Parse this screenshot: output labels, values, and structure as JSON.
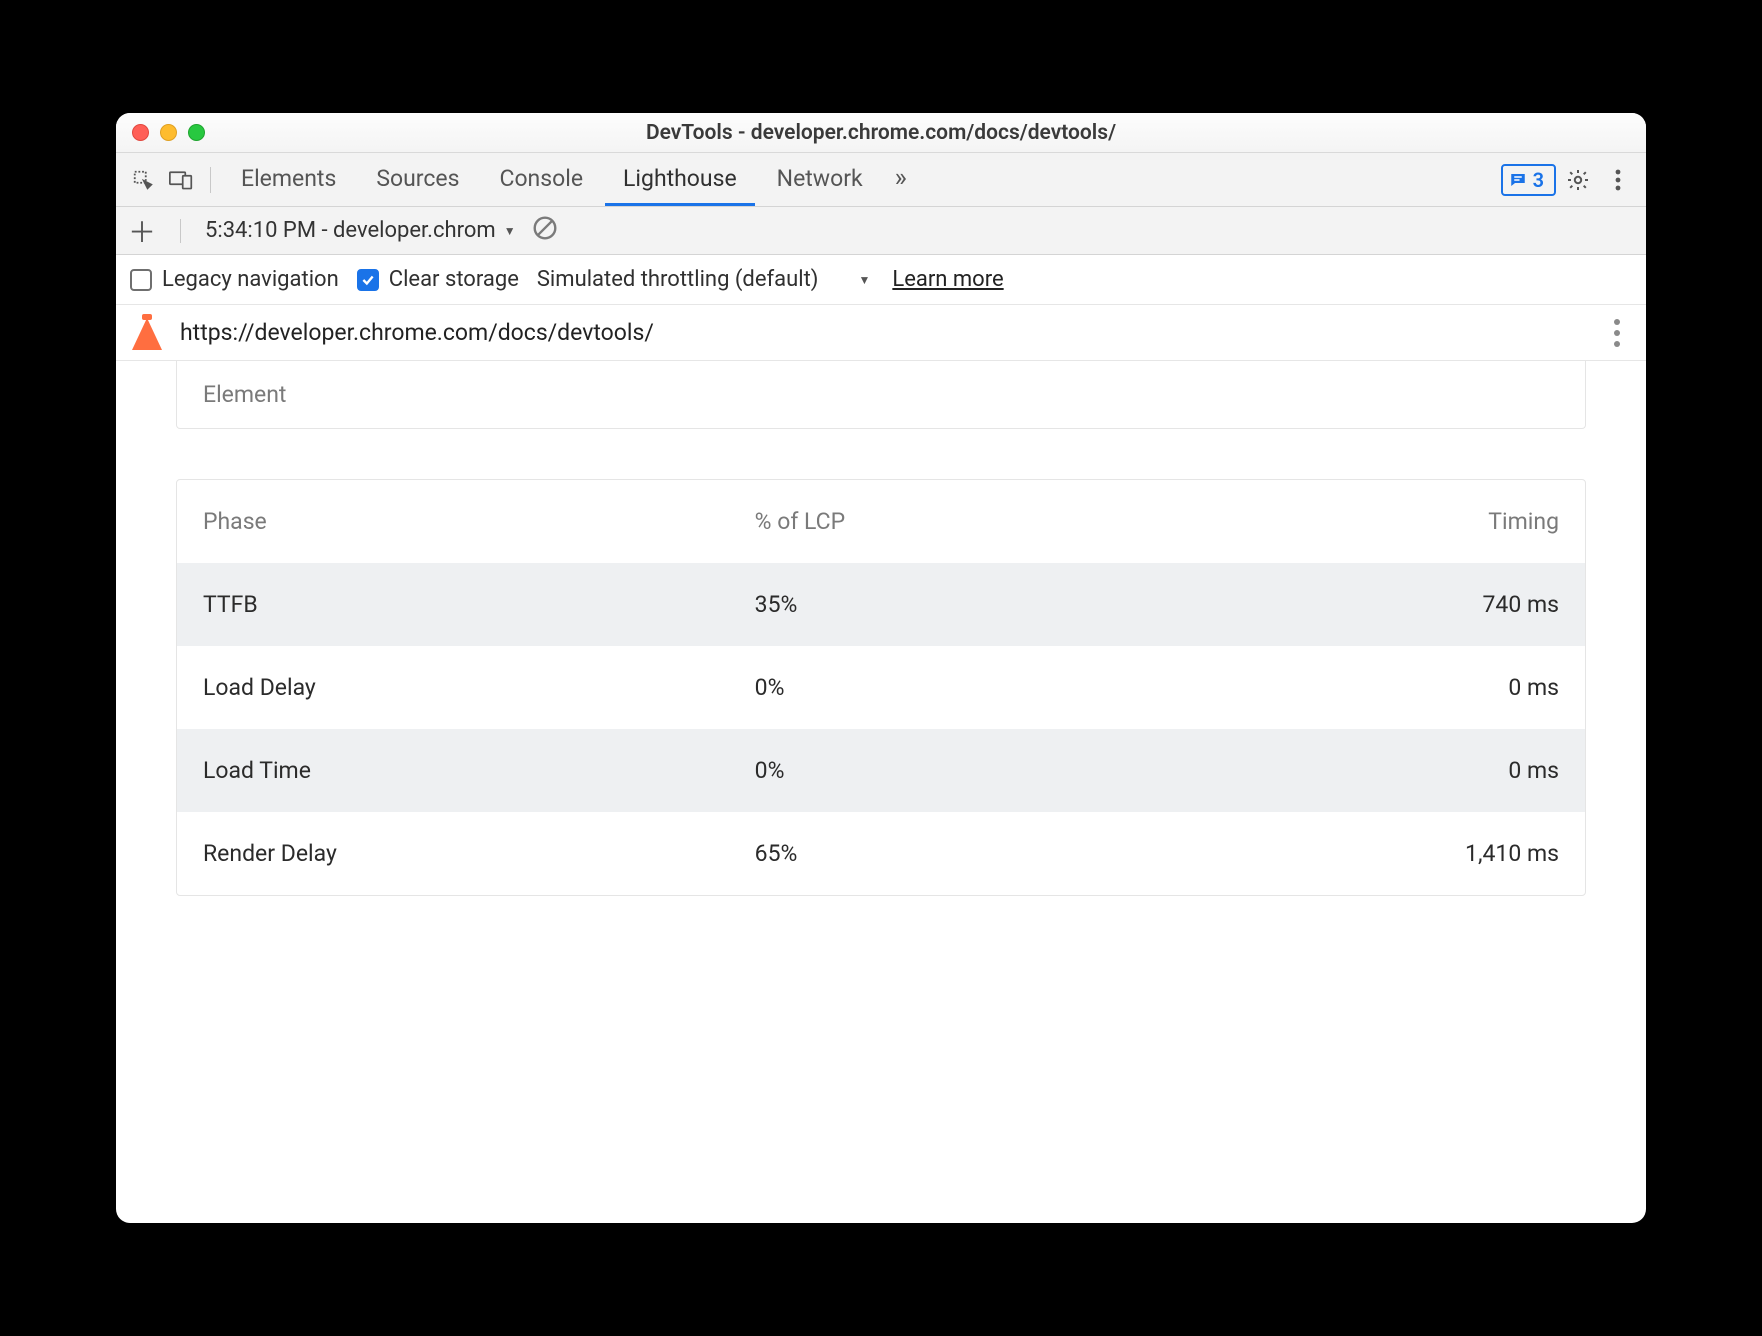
{
  "window": {
    "title": "DevTools - developer.chrome.com/docs/devtools/"
  },
  "tabs": {
    "items": [
      "Elements",
      "Sources",
      "Console",
      "Lighthouse",
      "Network"
    ],
    "active_index": 3,
    "more_indicator": "»",
    "badge_count": "3"
  },
  "subbar": {
    "report_label": "5:34:10 PM - developer.chrom"
  },
  "options": {
    "legacy_label": "Legacy navigation",
    "legacy_checked": false,
    "clear_label": "Clear storage",
    "clear_checked": true,
    "throttling_label": "Simulated throttling (default)",
    "learn_more": "Learn more"
  },
  "urlrow": {
    "url": "https://developer.chrome.com/docs/devtools/"
  },
  "panel": {
    "element_header": "Element",
    "columns": [
      "Phase",
      "% of LCP",
      "Timing"
    ],
    "rows": [
      {
        "phase": "TTFB",
        "pct": "35%",
        "timing": "740 ms"
      },
      {
        "phase": "Load Delay",
        "pct": "0%",
        "timing": "0 ms"
      },
      {
        "phase": "Load Time",
        "pct": "0%",
        "timing": "0 ms"
      },
      {
        "phase": "Render Delay",
        "pct": "65%",
        "timing": "1,410 ms"
      }
    ]
  }
}
